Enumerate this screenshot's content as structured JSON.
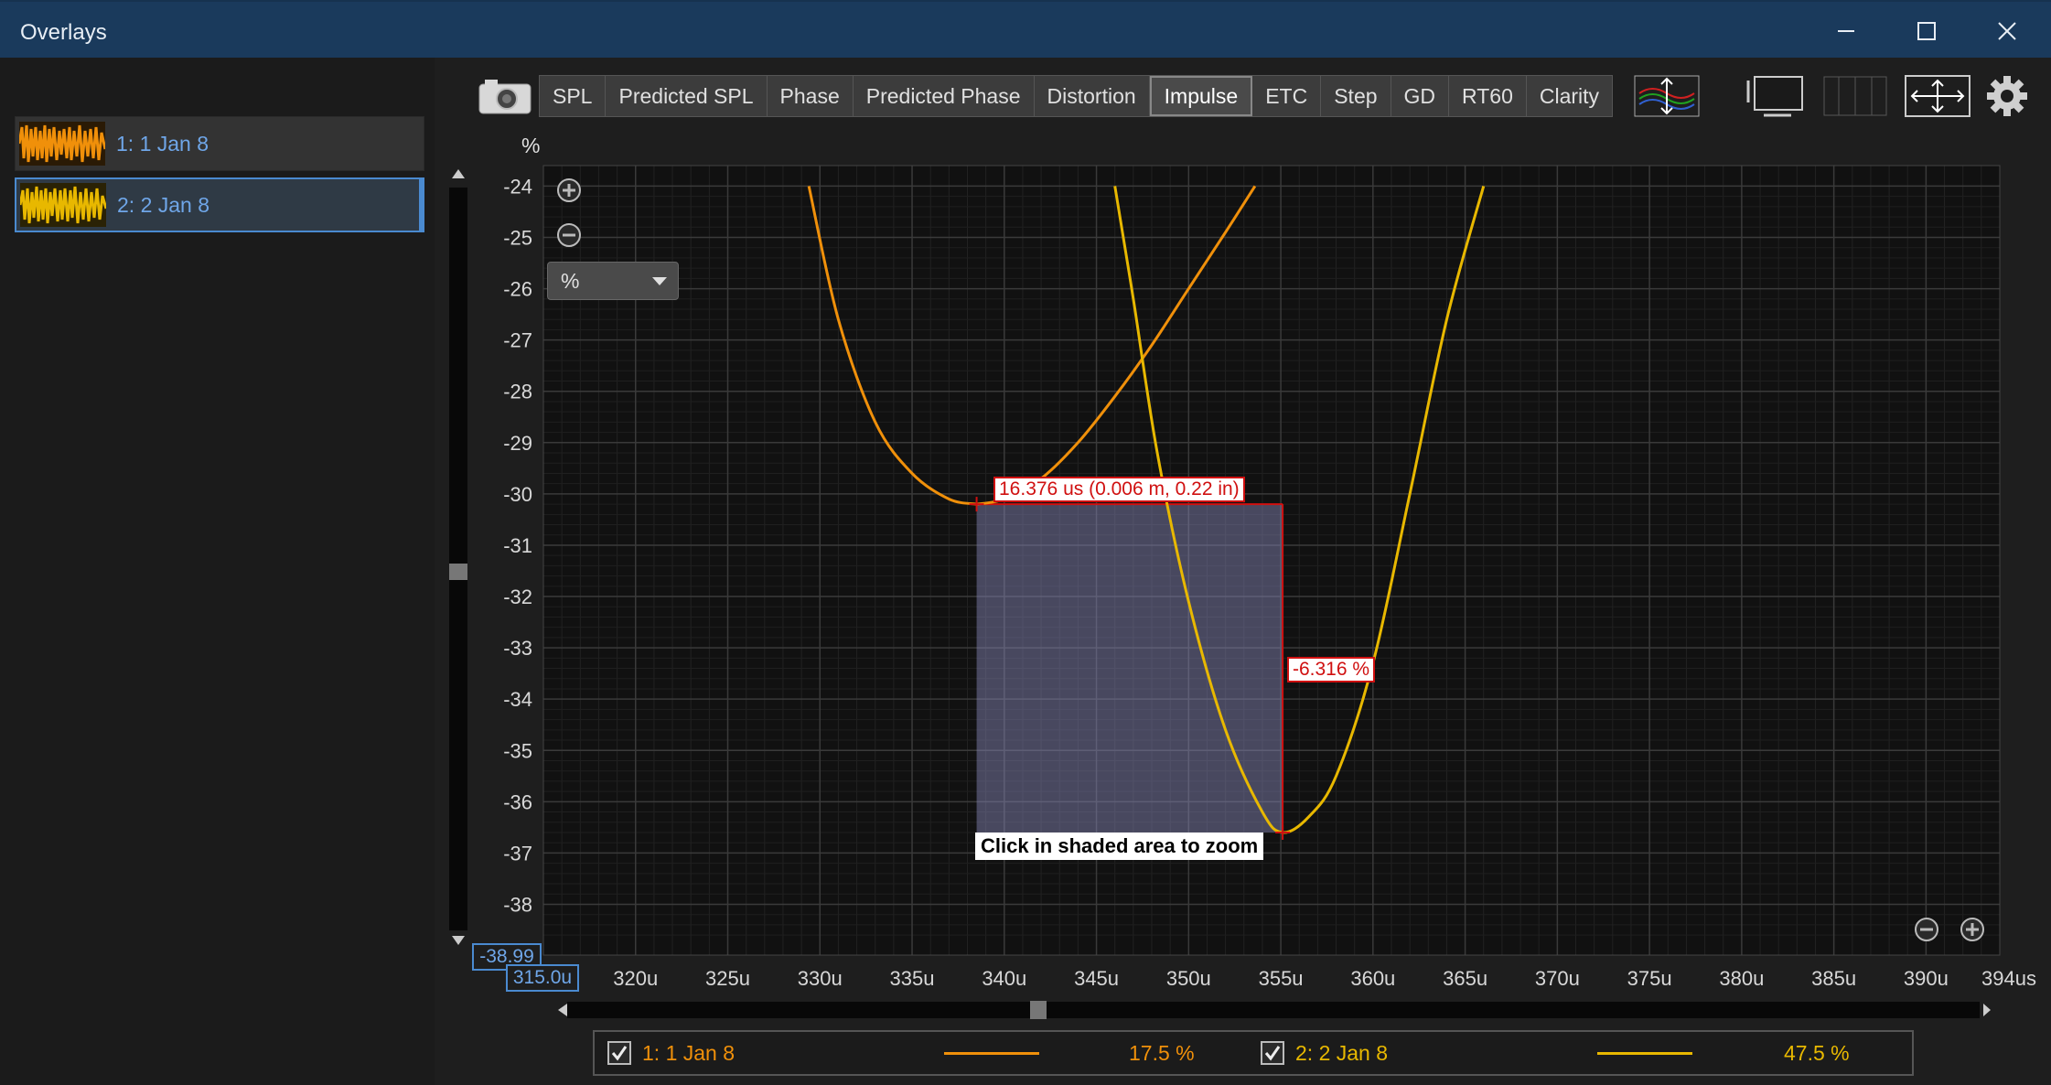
{
  "window": {
    "title": "Overlays"
  },
  "overlays": [
    {
      "label": "1: 1 Jan 8",
      "color": "#f0900a",
      "selected": false
    },
    {
      "label": "2: 2 Jan 8",
      "color": "#e8b800",
      "selected": true
    }
  ],
  "toolbar": {
    "tabs": [
      "SPL",
      "Predicted SPL",
      "Phase",
      "Predicted Phase",
      "Distortion",
      "Impulse",
      "ETC",
      "Step",
      "GD",
      "RT60",
      "Clarity"
    ],
    "active_tab": "Impulse",
    "icons": [
      "camera-icon",
      "overlay-controls-icon",
      "single-view-icon",
      "multi-view-icon",
      "fit-view-icon",
      "gear-icon"
    ]
  },
  "chart": {
    "y_unit": "%",
    "dropdown_value": "%",
    "y_min_readout": "-38.99",
    "x_start_readout": "315.0u",
    "x_end_label": "394us",
    "marker_dx_label": "16.376 us (0.006 m, 0.22 in)",
    "marker_dy_label": "-6.316 %",
    "zoom_hint": "Click in shaded area to zoom"
  },
  "chart_data": {
    "type": "line",
    "xlabel": "",
    "ylabel": "%",
    "x_unit": "us",
    "xlim": [
      315,
      394
    ],
    "ylim": [
      -38.99,
      -23.6
    ],
    "x_ticks": [
      "320u",
      "325u",
      "330u",
      "335u",
      "340u",
      "345u",
      "350u",
      "355u",
      "360u",
      "365u",
      "370u",
      "375u",
      "380u",
      "385u",
      "390u"
    ],
    "y_ticks": [
      -24,
      -25,
      -26,
      -27,
      -28,
      -29,
      -30,
      -31,
      -32,
      -33,
      -34,
      -35,
      -36,
      -37,
      -38
    ],
    "grid": true,
    "legend": "bottom",
    "series": [
      {
        "name": "1: 1 Jan 8",
        "color": "#f0900a",
        "segments": [
          {
            "x": [
              329.4,
              331,
              333,
              335,
              337,
              338.5
            ],
            "y": [
              -24,
              -26.6,
              -28.6,
              -29.6,
              -30.1,
              -30.2
            ]
          },
          {
            "x": [
              338.5,
              340,
              342,
              344,
              346,
              348,
              350,
              352,
              353.6
            ],
            "y": [
              -30.2,
              -30.1,
              -29.7,
              -29.0,
              -28.1,
              -27.1,
              -26.0,
              -24.9,
              -24
            ]
          }
        ]
      },
      {
        "name": "2: 2 Jan 8",
        "color": "#e8b800",
        "segments": [
          {
            "x": [
              346.0,
              347,
              348.3,
              350,
              352,
              354,
              355.1,
              356.5,
              358,
              360,
              362,
              364,
              366.0
            ],
            "y": [
              -24,
              -26.2,
              -29.2,
              -32.1,
              -34.6,
              -36.2,
              -36.6,
              -36.3,
              -35.5,
              -33.3,
              -30.0,
              -26.6,
              -24
            ]
          }
        ]
      }
    ],
    "selection": {
      "x": [
        338.5,
        355.1
      ],
      "y": [
        -36.6,
        -30.2
      ]
    },
    "annotations": [
      "16.376 us (0.006 m, 0.22 in)",
      "-6.316 %",
      "Click in shaded area to zoom"
    ]
  },
  "legend": [
    {
      "label": "1: 1 Jan 8",
      "value": "17.5 %",
      "color": "#f0900a",
      "checked": true
    },
    {
      "label": "2: 2 Jan 8",
      "value": "47.5 %",
      "color": "#e8b800",
      "checked": true
    }
  ]
}
